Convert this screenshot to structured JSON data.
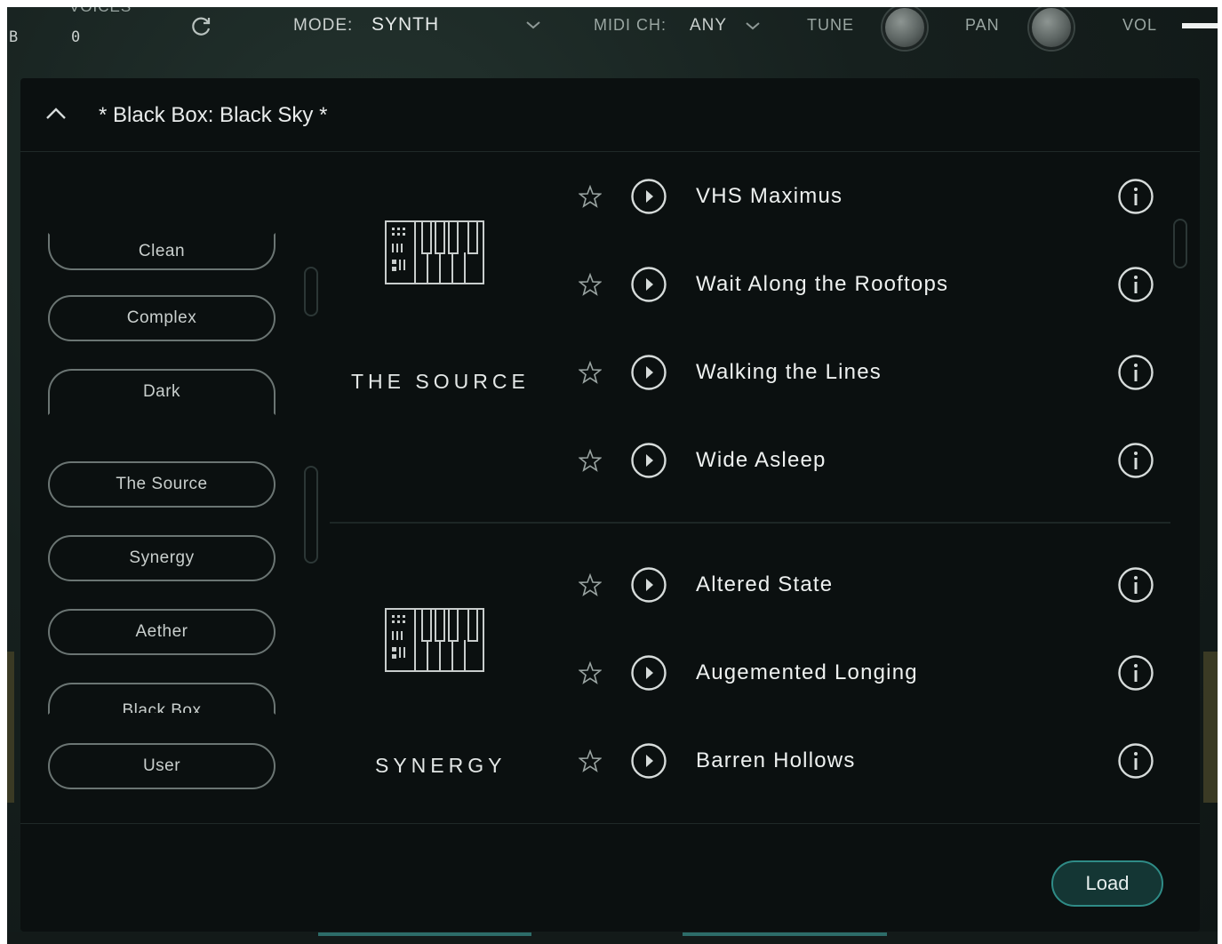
{
  "topbar": {
    "left_label": "B",
    "voices_label": "VOICES",
    "voices_value": "0",
    "mode_label": "MODE:",
    "mode_value": "SYNTH",
    "midi_label": "MIDI CH:",
    "midi_value": "ANY",
    "tune_label": "TUNE",
    "pan_label": "PAN",
    "vol_label": "VOL"
  },
  "browser": {
    "preset_title": "* Black Box: Black Sky *",
    "filters": [
      "Clean",
      "Complex",
      "Dark"
    ],
    "libraries": [
      "The Source",
      "Synergy",
      "Aether",
      "Black Box",
      "User"
    ],
    "groups": [
      {
        "library": "THE SOURCE",
        "presets": [
          "VHS Maximus",
          "Wait Along the Rooftops",
          "Walking the Lines",
          "Wide Asleep"
        ]
      },
      {
        "library": "SYNERGY",
        "presets": [
          "Altered State",
          "Augemented Longing",
          "Barren Hollows"
        ]
      }
    ],
    "load_label": "Load"
  },
  "colors": {
    "panel_bg": "#0b1010",
    "accent": "#2f8b86",
    "text": "#eef1f0"
  },
  "icons": [
    "refresh-icon",
    "chevron-down-icon",
    "chevron-up-icon",
    "star-icon",
    "play-icon",
    "info-icon",
    "keyboard-icon"
  ]
}
